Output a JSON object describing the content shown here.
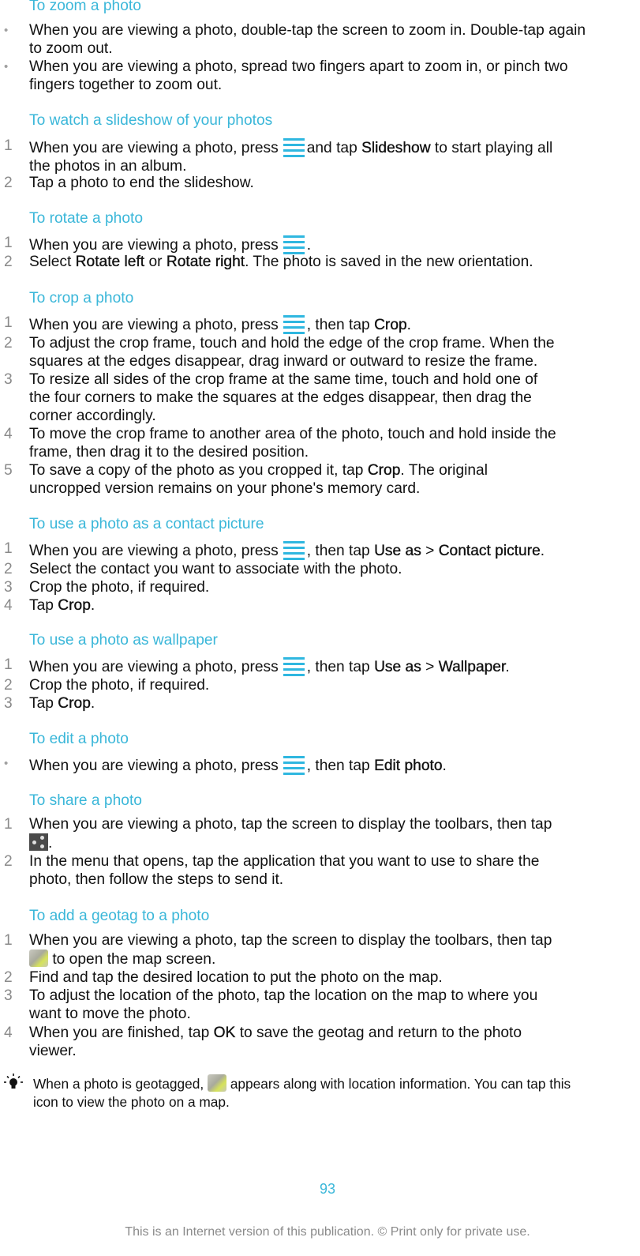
{
  "sections": [
    {
      "heading": "To zoom a photo",
      "items": [
        {
          "marker": "•",
          "parts": [
            "When you are viewing a photo, double-tap the screen to zoom in. Double-tap again",
            "to zoom out."
          ]
        },
        {
          "marker": "•",
          "parts": [
            "When you are viewing a photo, spread two fingers apart to zoom in, or pinch two",
            "fingers together to zoom out."
          ]
        }
      ]
    },
    {
      "heading": "To watch a slideshow of your photos",
      "items": [
        {
          "marker": "1",
          "pre": "When you are viewing a photo, press",
          "mid": "and tap",
          "bold": "Slideshow",
          "post": "to start playing all",
          "line2": "the photos in an album."
        },
        {
          "marker": "2",
          "text": "Tap a photo to end the slideshow."
        }
      ]
    },
    {
      "heading": "To rotate a photo",
      "items": [
        {
          "marker": "1",
          "pre": "When you are viewing a photo, press",
          "post": "."
        },
        {
          "marker": "2",
          "pre": "Select",
          "bold1": "Rotate left",
          "mid": "or",
          "bold2": "Rotate right",
          "post": ". The photo is saved in the new orientation."
        }
      ]
    },
    {
      "heading": "To crop a photo",
      "items": [
        {
          "marker": "1",
          "pre": "When you are viewing a photo, press",
          "mid": ", then tap",
          "bold": "Crop",
          "post": "."
        },
        {
          "marker": "2",
          "lines": [
            "To adjust the crop frame, touch and hold the edge of the crop frame. When the",
            "squares at the edges disappear, drag inward or outward to resize the frame."
          ]
        },
        {
          "marker": "3",
          "lines": [
            "To resize all sides of the crop frame at the same time, touch and hold one of",
            "the four corners to make the squares at the edges disappear, then drag the",
            "corner accordingly."
          ]
        },
        {
          "marker": "4",
          "lines": [
            "To move the crop frame to another area of the photo, touch and hold inside the",
            "frame, then drag it to the desired position."
          ]
        },
        {
          "marker": "5",
          "pre": "To save a copy of the photo as you cropped it, tap",
          "bold": "Crop",
          "post": ". The original",
          "line2": "uncropped version remains on your phone's memory card."
        }
      ]
    },
    {
      "heading": "To use a photo as a contact picture",
      "items": [
        {
          "marker": "1",
          "pre": "When you are viewing a photo, press",
          "mid": ", then tap",
          "bold1": "Use as",
          "sep": ">",
          "bold2": "Contact picture",
          "post": "."
        },
        {
          "marker": "2",
          "text": "Select the contact you want to associate with the photo."
        },
        {
          "marker": "3",
          "text": "Crop the photo, if required."
        },
        {
          "marker": "4",
          "pre": "Tap",
          "bold": "Crop",
          "post": "."
        }
      ]
    },
    {
      "heading": "To use a photo as wallpaper",
      "items": [
        {
          "marker": "1",
          "pre": "When you are viewing a photo, press",
          "mid": ", then tap",
          "bold1": "Use as",
          "sep": ">",
          "bold2": "Wallpaper",
          "post": "."
        },
        {
          "marker": "2",
          "text": "Crop the photo, if required."
        },
        {
          "marker": "3",
          "pre": "Tap",
          "bold": "Crop",
          "post": "."
        }
      ]
    },
    {
      "heading": "To edit a photo",
      "items": [
        {
          "marker": "•",
          "pre": "When you are viewing a photo, press",
          "mid": ", then tap",
          "bold": "Edit photo",
          "post": "."
        }
      ]
    },
    {
      "heading": "To share a photo",
      "items": [
        {
          "marker": "1",
          "line1": "When you are viewing a photo, tap the screen to display the toolbars, then tap",
          "post": "."
        },
        {
          "marker": "2",
          "lines": [
            "In the menu that opens, tap the application that you want to use to share the",
            "photo, then follow the steps to send it."
          ]
        }
      ]
    },
    {
      "heading": "To add a geotag to a photo",
      "items": [
        {
          "marker": "1",
          "line1": "When you are viewing a photo, tap the screen to display the toolbars, then tap",
          "post": "to open the map screen."
        },
        {
          "marker": "2",
          "text": "Find and tap the desired location to put the photo on the map."
        },
        {
          "marker": "3",
          "lines": [
            "To adjust the location of the photo, tap the location on the map to where you",
            "want to move the photo."
          ]
        },
        {
          "marker": "4",
          "pre": "When you are finished, tap",
          "bold": "OK",
          "post": "to save the geotag and return to the photo",
          "line2": "viewer."
        }
      ]
    }
  ],
  "tip": {
    "pre": "When a photo is geotagged,",
    "post": "appears along with location information. You can tap this",
    "line2": "icon to view the photo on a map."
  },
  "page_number": "93",
  "footer": "This is an Internet version of this publication. © Print only for private use.",
  "colors": {
    "heading": "#3bb7d9",
    "menu_icon": "#2fb7e0",
    "marker": "#8a8a8a"
  }
}
